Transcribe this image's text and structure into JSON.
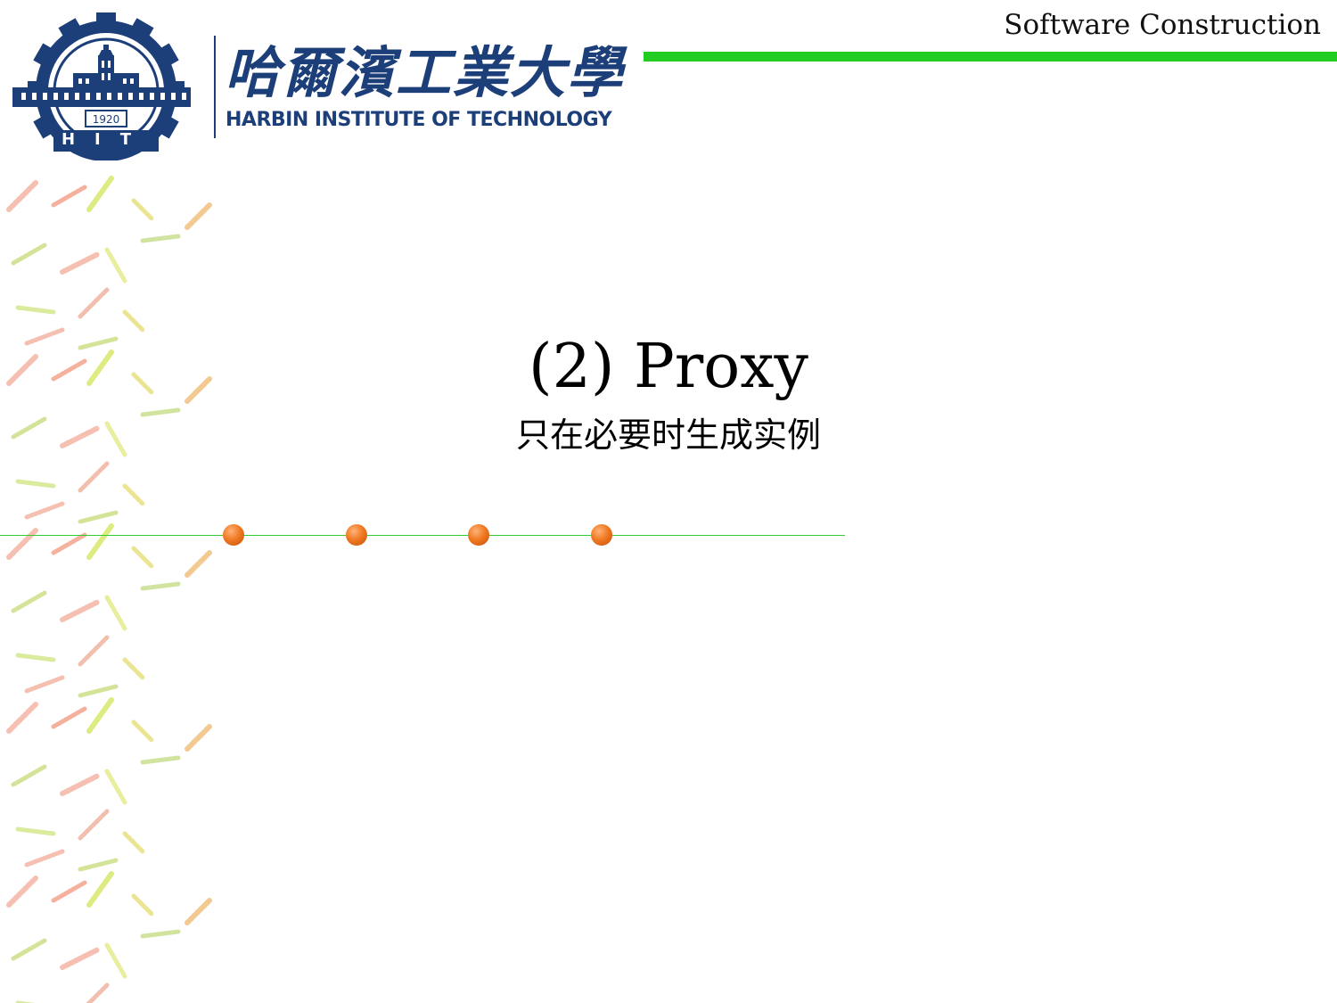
{
  "header": {
    "course_title": "Software Construction",
    "accent_color": "#22cc22"
  },
  "logo": {
    "year": "1920",
    "initials": "HIT",
    "chinese_name": "哈爾濱工業大學",
    "english_name": "HARBIN INSTITUTE OF TECHNOLOGY",
    "color": "#1c3f7a",
    "icon": "gear-emblem-icon"
  },
  "slide": {
    "title": "(2) Proxy",
    "subtitle": "只在必要时生成实例"
  },
  "divider": {
    "line_color": "#33cc33",
    "dot_color": "#f07a22",
    "dot_count": 4
  }
}
